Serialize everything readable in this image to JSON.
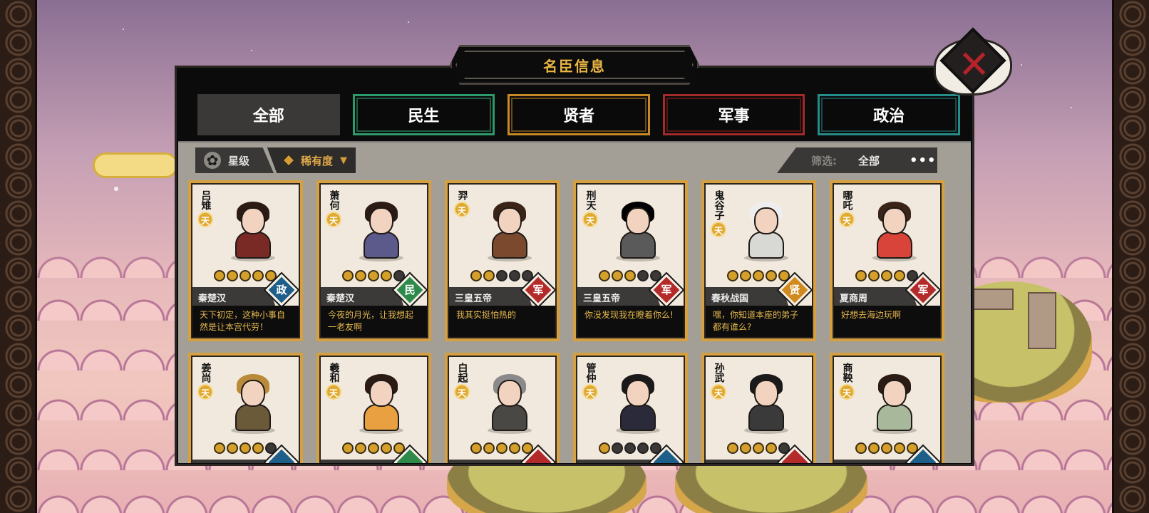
{
  "panel": {
    "title": "名臣信息"
  },
  "close_button": {
    "label": "✕"
  },
  "tabs": [
    {
      "label": "全部"
    },
    {
      "label": "民生"
    },
    {
      "label": "贤者"
    },
    {
      "label": "军事"
    },
    {
      "label": "政治"
    }
  ],
  "sort": {
    "star_label": "星级",
    "rarity_label": "稀有度"
  },
  "filter": {
    "label": "筛选:",
    "value": "全部",
    "more": "•••"
  },
  "tier_badge": "天",
  "colors": {
    "accent_gold": "#e9b544",
    "type_zheng": "#1e5f8a",
    "type_min": "#2d8a4a",
    "type_jun": "#b42a2a",
    "type_xian": "#d08a1e"
  },
  "cards": [
    {
      "name": "吕雉",
      "stars": 5,
      "era": "秦楚汉",
      "type": "政",
      "type_color": "#1e5f8a",
      "quote": "天下初定，这种小事自然是让本宫代劳！",
      "robe": "#7a2a24",
      "hair": "#2b1b14"
    },
    {
      "name": "萧何",
      "stars": 4,
      "era": "秦楚汉",
      "type": "民",
      "type_color": "#2d8a4a",
      "quote": "今夜的月光，让我想起一老友啊",
      "robe": "#5b5a8a",
      "hair": "#2b1b14"
    },
    {
      "name": "羿",
      "stars": 2,
      "era": "三皇五帝",
      "type": "军",
      "type_color": "#b42a2a",
      "quote": "我其实挺怕热的",
      "robe": "#7b4a2e",
      "hair": "#3a2418"
    },
    {
      "name": "刑天",
      "stars": 3,
      "era": "三皇五帝",
      "type": "军",
      "type_color": "#b42a2a",
      "quote": "你没发现我在瞪着你么!",
      "robe": "#5a5a5a",
      "hair": "#000000"
    },
    {
      "name": "鬼谷子",
      "stars": 5,
      "era": "春秋战国",
      "type": "贤",
      "type_color": "#d08a1e",
      "quote": "嘿，你知道本座的弟子都有谁么?",
      "robe": "#d8d8d4",
      "hair": "#eeeeee"
    },
    {
      "name": "哪吒",
      "stars": 4,
      "era": "夏商周",
      "type": "军",
      "type_color": "#b42a2a",
      "quote": "好想去海边玩啊",
      "robe": "#d8443a",
      "hair": "#3a2418"
    },
    {
      "name": "姜尚",
      "stars": 4,
      "era": "",
      "type": "",
      "type_color": "#1e5f8a",
      "quote": "",
      "robe": "#6a5a3a",
      "hair": "#b88a3a"
    },
    {
      "name": "羲和",
      "stars": 5,
      "era": "",
      "type": "",
      "type_color": "#2d8a4a",
      "quote": "",
      "robe": "#e8a040",
      "hair": "#2b1b14"
    },
    {
      "name": "白起",
      "stars": 5,
      "era": "",
      "type": "",
      "type_color": "#b42a2a",
      "quote": "",
      "robe": "#4a4844",
      "hair": "#8a8a8a"
    },
    {
      "name": "管仲",
      "stars": 1,
      "era": "",
      "type": "",
      "type_color": "#1e5f8a",
      "quote": "",
      "robe": "#2a2a3a",
      "hair": "#1a1a1a"
    },
    {
      "name": "孙武",
      "stars": 4,
      "era": "",
      "type": "",
      "type_color": "#b42a2a",
      "quote": "",
      "robe": "#3a3a3a",
      "hair": "#1a1a1a"
    },
    {
      "name": "商鞅",
      "stars": 5,
      "era": "",
      "type": "",
      "type_color": "#1e5f8a",
      "quote": "",
      "robe": "#a8b89a",
      "hair": "#2b1b14"
    }
  ]
}
